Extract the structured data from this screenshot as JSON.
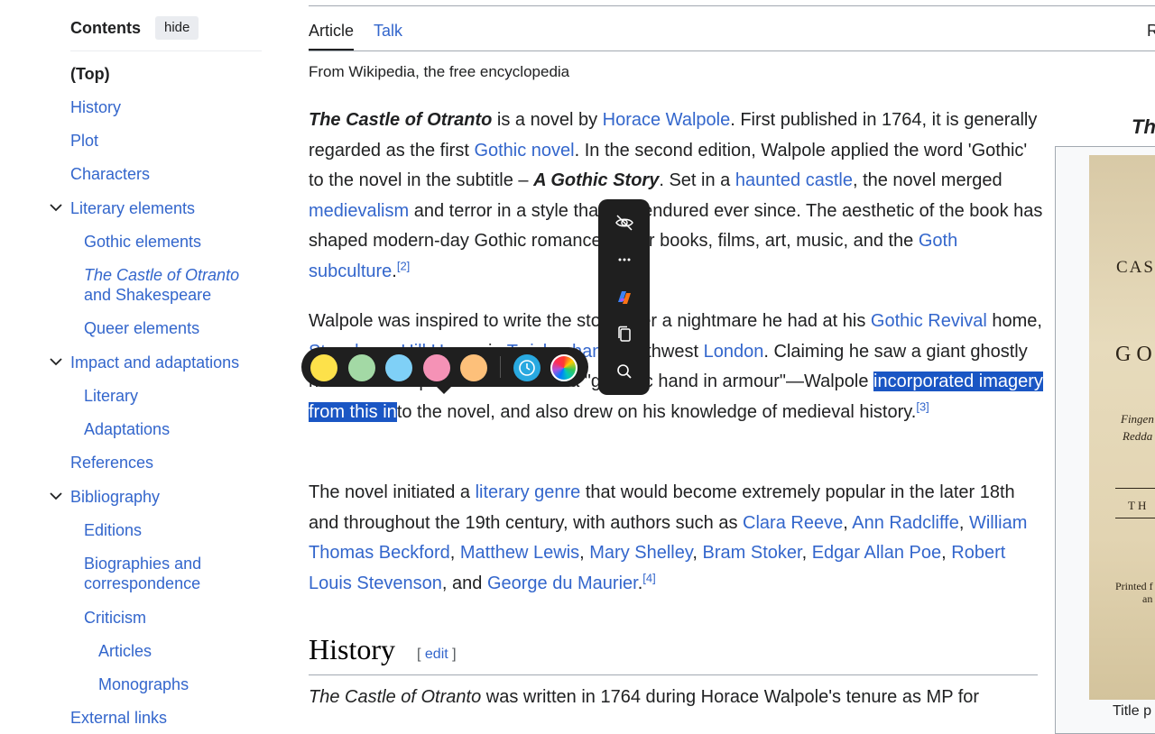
{
  "toc": {
    "title": "Contents",
    "hide_label": "hide",
    "items": [
      {
        "label": "(Top)"
      },
      {
        "label": "History"
      },
      {
        "label": "Plot"
      },
      {
        "label": "Characters"
      },
      {
        "label": "Literary elements"
      },
      {
        "label": "Gothic elements"
      },
      {
        "label": "The Castle of Otranto",
        "label2": "and Shakespeare"
      },
      {
        "label": "Queer elements"
      },
      {
        "label": "Impact and adaptations"
      },
      {
        "label": "Literary"
      },
      {
        "label": "Adaptations"
      },
      {
        "label": "References"
      },
      {
        "label": "Bibliography"
      },
      {
        "label": "Editions"
      },
      {
        "label": "Biographies and",
        "label2": "correspondence"
      },
      {
        "label": "Criticism"
      },
      {
        "label": "Articles"
      },
      {
        "label": "Monographs"
      },
      {
        "label": "External links"
      }
    ]
  },
  "tabs": {
    "article": "Article",
    "talk": "Talk",
    "right_partial": "R"
  },
  "tagline": "From Wikipedia, the free encyclopedia",
  "p1": {
    "t1": "The Castle of Otranto",
    "t2": " is a novel by ",
    "l1": "Horace Walpole",
    "t3": ". First published in 1764, it is generally regarded as the first ",
    "l2": "Gothic novel",
    "t4": ". In the second edition, Walpole applied the word 'Gothic' to the novel in the subtitle – ",
    "t5": "A Gothic Story",
    "t6": ". Set in a ",
    "l3": "haunted castle",
    "t7": ", the novel merged ",
    "l4": "medievalism",
    "t8": " and terror in a style that has endured ever since. The aesthetic of the book has shaped modern-day Gothic romance/horror books, films, art, music, and the ",
    "l5": "Goth subculture",
    "t9": ".",
    "ref": "[2]"
  },
  "p2": {
    "t1": "Walpole was inspired to write the story after a nightmare he had at his ",
    "l1": "Gothic Revival",
    "t2": " home, ",
    "l2": "Strawberry Hill House",
    "t3": " in ",
    "l3": "Twickenham",
    "t4": ", southwest ",
    "l4": "London",
    "t5": ". Claiming he saw a giant ghostly hand at the top of a staircase — a \"gigantic hand in armour\"—Walpole ",
    "sel": "incorporated imagery from this in",
    "t6": "to the novel, and also drew on his knowledge of medieval history.",
    "ref": "[3]"
  },
  "p3": {
    "t1": "The novel initiated a ",
    "l1": "literary genre",
    "t2": " that would become extremely popular in the later 18th and throughout the 19th century, with authors such as ",
    "l2": "Clara Reeve",
    "t3": ", ",
    "l3": "Ann Radcliffe",
    "t4": ", ",
    "l4": "William Thomas Beckford",
    "t5": ", ",
    "l5": "Matthew Lewis",
    "t6": ", ",
    "l6": "Mary Shelley",
    "t7": ", ",
    "l7": "Bram Stoker",
    "t8": ", ",
    "l8": "Edgar Allan Poe",
    "t9": ", ",
    "l9": "Robert Louis Stevenson",
    "t10": ", and ",
    "l10": "George du Maurier",
    "t11": ".",
    "ref": "[4]"
  },
  "history": {
    "heading": "History",
    "edit_open": "[ ",
    "edit_label": "edit",
    "edit_close": " ]",
    "first_line_italic": "The Castle of Otranto",
    "first_line_rest": " was written in 1764 during Horace Walpole's tenure as MP for"
  },
  "infobox": {
    "title_partial": "Th",
    "img_lines": [
      "CAS",
      "GO",
      "Fingen",
      "Redda",
      "TH",
      "Printed f",
      "an"
    ],
    "caption_partial": "Title p"
  },
  "palette": {
    "colors": [
      "#fde14a",
      "#a3d9a5",
      "#7fd0f7",
      "#f592b6",
      "#fdc07a"
    ],
    "icons": [
      "history-icon",
      "color-wheel-icon"
    ]
  },
  "toolbar": {
    "icons": [
      "hide-eye-icon",
      "more-icon",
      "copilot-icon",
      "copy-icon",
      "search-icon"
    ]
  }
}
